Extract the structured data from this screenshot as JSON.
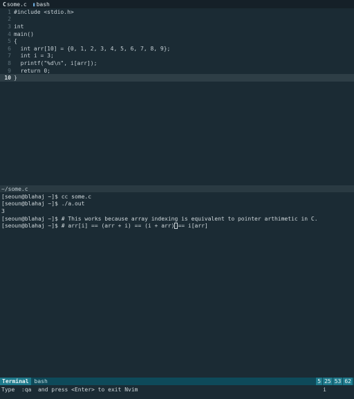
{
  "tabs": [
    {
      "icon": "C",
      "label": "some.c"
    },
    {
      "icon": "▮",
      "label": "bash"
    }
  ],
  "editor": {
    "lines": [
      {
        "num": "1",
        "text": "#include <stdio.h>"
      },
      {
        "num": "2",
        "text": ""
      },
      {
        "num": "3",
        "text": "int"
      },
      {
        "num": "4",
        "text": "main()"
      },
      {
        "num": "5",
        "text": "{"
      },
      {
        "num": "6",
        "text": "  int arr[10] = {0, 1, 2, 3, 4, 5, 6, 7, 8, 9};"
      },
      {
        "num": "7",
        "text": "  int i = 3;"
      },
      {
        "num": "8",
        "text": "  printf(\"%d\\n\", i[arr]);"
      },
      {
        "num": "9",
        "text": "  return 0;"
      },
      {
        "num": "10",
        "text": "}"
      }
    ],
    "current_line": "10"
  },
  "split_status": "~/some.c",
  "terminal": {
    "lines": [
      "[seoun@blahaj ~]$ cc some.c",
      "[seoun@blahaj ~]$ ./a.out",
      "3",
      "[seoun@blahaj ~]$ # This works because array indexing is equivalent to pointer arthimetic in C.",
      "[seoun@blahaj ~]$ # arr[i] == (arr + i) == (i + arr)"
    ],
    "cursor_after": "== i[arr]"
  },
  "statusline": {
    "mode": "Terminal",
    "file": "bash",
    "pos": [
      "5",
      "25",
      "53",
      "62"
    ]
  },
  "message": {
    "text": "Type  :qa  and press <Enter> to exit Nvim",
    "right": "i"
  },
  "colors": {
    "background": "#1b2b34",
    "cursorline": "#2e3e46",
    "statusline": "#0e4a5a",
    "mode": "#1e7a8c"
  }
}
